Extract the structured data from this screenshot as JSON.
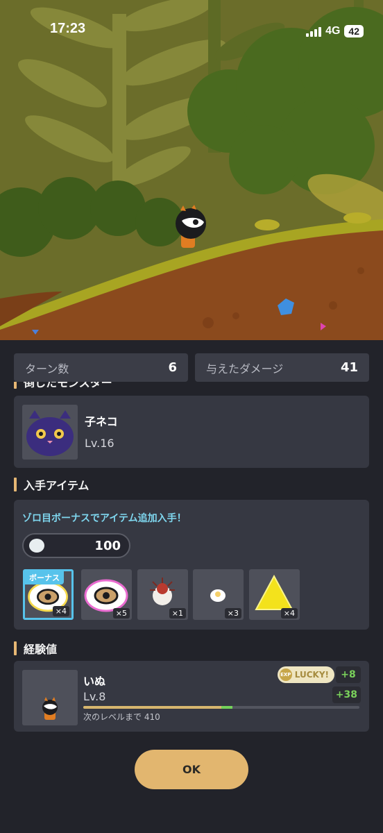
{
  "status_bar": {
    "time": "17:23",
    "network": "4G",
    "battery": "42"
  },
  "stats": {
    "turns": {
      "label": "ターン数",
      "value": "6"
    },
    "damage": {
      "label": "与えたダメージ",
      "value": "41"
    }
  },
  "defeated": {
    "title": "倒したモンスター",
    "monster": {
      "name": "子ネコ",
      "level": "Lv.16"
    }
  },
  "items": {
    "title": "入手アイテム",
    "bonus_message": "ゾロ目ボーナスでアイテム追加入手！",
    "coins": "100",
    "bonus_tag": "ボーナス",
    "list": [
      {
        "icon": "rainbow-eye-cloud-icon",
        "qty": "×4",
        "bonus": true
      },
      {
        "icon": "rainbow-eye-cloud-icon",
        "qty": "×5"
      },
      {
        "icon": "spiky-seed-icon",
        "qty": "×1"
      },
      {
        "icon": "glowing-egg-icon",
        "qty": "×3"
      },
      {
        "icon": "yellow-triangle-icon",
        "qty": "×4"
      }
    ]
  },
  "experience": {
    "title": "経験値",
    "character": {
      "name": "いぬ",
      "level": "Lv.8"
    },
    "lucky_badge": "LUCKY!",
    "exp_label": "EXP",
    "gain_lucky": "+8",
    "gain_total": "+38",
    "next_level_label": "次のレベルまで 410",
    "progress": 0.5,
    "gain_progress": 0.04
  },
  "ok_label": "OK",
  "colors": {
    "accent": "#e2b66f",
    "bonus": "#57c3eb",
    "gain": "#7ad15b",
    "panel": "#22232a",
    "card": "#363842"
  }
}
